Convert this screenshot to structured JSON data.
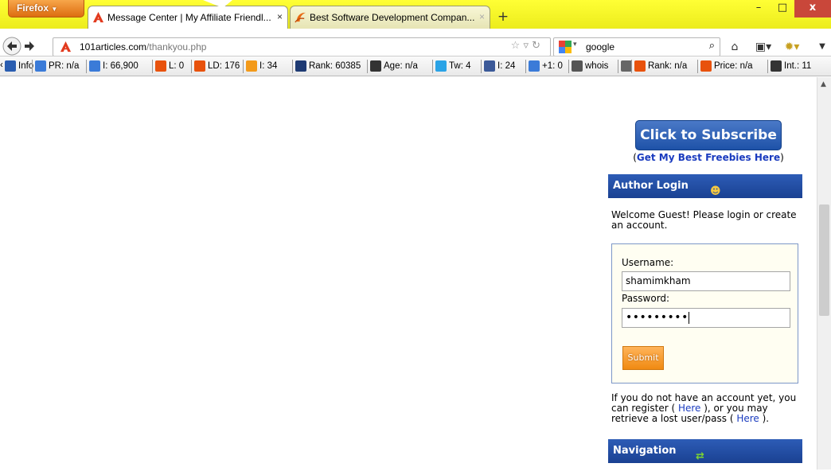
{
  "browser": {
    "app_button": "Firefox",
    "tabs": [
      {
        "title": "Message Center | My Affiliate Friendl...",
        "close": "×"
      },
      {
        "title": "Best Software Development Compan...",
        "close": "×"
      }
    ],
    "new_tab": "+",
    "window_controls": {
      "minimize": "–",
      "maximize": "□",
      "close": "x"
    },
    "url": {
      "host": "101articles.com",
      "path": "/thankyou.php"
    },
    "search": {
      "engine": "google",
      "value": "google"
    }
  },
  "seo_toolbar": {
    "items": [
      {
        "icon": "info-icon",
        "text": "Info",
        "color": "#2a5db0"
      },
      {
        "icon": "google-pr-icon",
        "text": "PR: n/a",
        "color": "#3b7bd8"
      },
      {
        "icon": "google-index-icon",
        "text": "I: 66,900",
        "color": "#3b7bd8"
      },
      {
        "icon": "yahoo-links-icon",
        "text": "L: 0",
        "color": "#e8520d"
      },
      {
        "icon": "yahoo-ld-icon",
        "text": "LD: 176",
        "color": "#e8520d"
      },
      {
        "icon": "bing-index-icon",
        "text": "I: 34",
        "color": "#f39a1a"
      },
      {
        "icon": "alexa-icon",
        "text": "Rank: 60385",
        "color": "#1e3a73"
      },
      {
        "icon": "archive-icon",
        "text": "Age: n/a",
        "color": "#333333"
      },
      {
        "icon": "twitter-icon",
        "text": "Tw: 4",
        "color": "#2aa3e6"
      },
      {
        "icon": "facebook-icon",
        "text": "I: 24",
        "color": "#3b5998"
      },
      {
        "icon": "google-plus-icon",
        "text": "+1: 0",
        "color": "#3b7bd8"
      },
      {
        "icon": "whois-icon",
        "text": "whois",
        "color": "#555555"
      },
      {
        "icon": "source-icon",
        "text": "",
        "color": "#666666"
      },
      {
        "icon": "semrush-rank-icon",
        "text": "Rank: n/a",
        "color": "#e8520d"
      },
      {
        "icon": "semrush-price-icon",
        "text": "Price: n/a",
        "color": "#e8520d"
      },
      {
        "icon": "internal-links-icon",
        "text": "Int.: 11",
        "color": "#333333"
      }
    ]
  },
  "sidebar": {
    "subscribe_button": "Click to Subscribe",
    "freebies": {
      "open": "(",
      "link": "Get My Best Freebies Here",
      "close": ")"
    },
    "author_login": {
      "heading": "Author Login",
      "welcome": "Welcome Guest! Please login or create an account.",
      "username_label": "Username:",
      "username_value": "shamimkham",
      "password_label": "Password:",
      "password_value": "•••••••••",
      "submit_label": "Submit"
    },
    "register": {
      "part1": "If you do not have an account yet, you can register (",
      "link1": " Here ",
      "part2": "), or you may retrieve a lost user/pass (",
      "link2": " Here ",
      "part3": ")."
    },
    "navigation_heading": "Navigation"
  },
  "colors": {
    "tabbar": "#ffff35",
    "firefox_button": "#dd6d10",
    "sidebar_header": "#1a4192",
    "submit_button": "#f08a12",
    "link": "#1a3bbf"
  }
}
